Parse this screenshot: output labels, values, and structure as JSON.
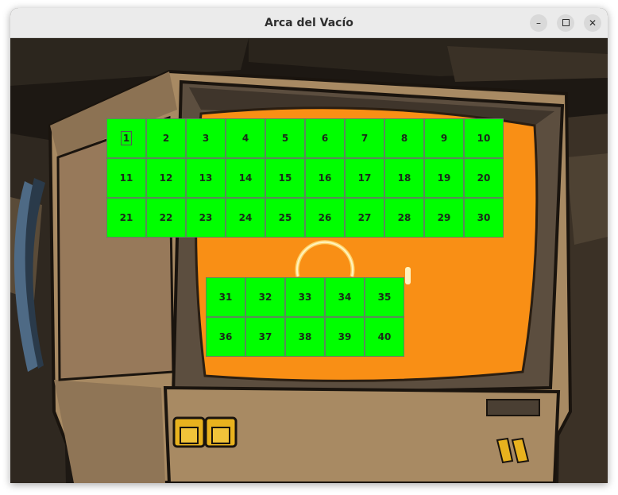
{
  "window": {
    "title": "Arca del Vacío",
    "minimize_glyph": "–",
    "close_glyph": "✕"
  },
  "colors": {
    "button_bg": "#00ff00",
    "screen_orange": "#f98f15",
    "monitor_beige": "#a88a63"
  },
  "grid_top": {
    "cells": [
      "1",
      "2",
      "3",
      "4",
      "5",
      "6",
      "7",
      "8",
      "9",
      "10",
      "11",
      "12",
      "13",
      "14",
      "15",
      "16",
      "17",
      "18",
      "19",
      "20",
      "21",
      "22",
      "23",
      "24",
      "25",
      "26",
      "27",
      "28",
      "29",
      "30"
    ],
    "focused": "1"
  },
  "grid_bottom": {
    "cells": [
      "31",
      "32",
      "33",
      "34",
      "35",
      "36",
      "37",
      "38",
      "39",
      "40"
    ]
  }
}
